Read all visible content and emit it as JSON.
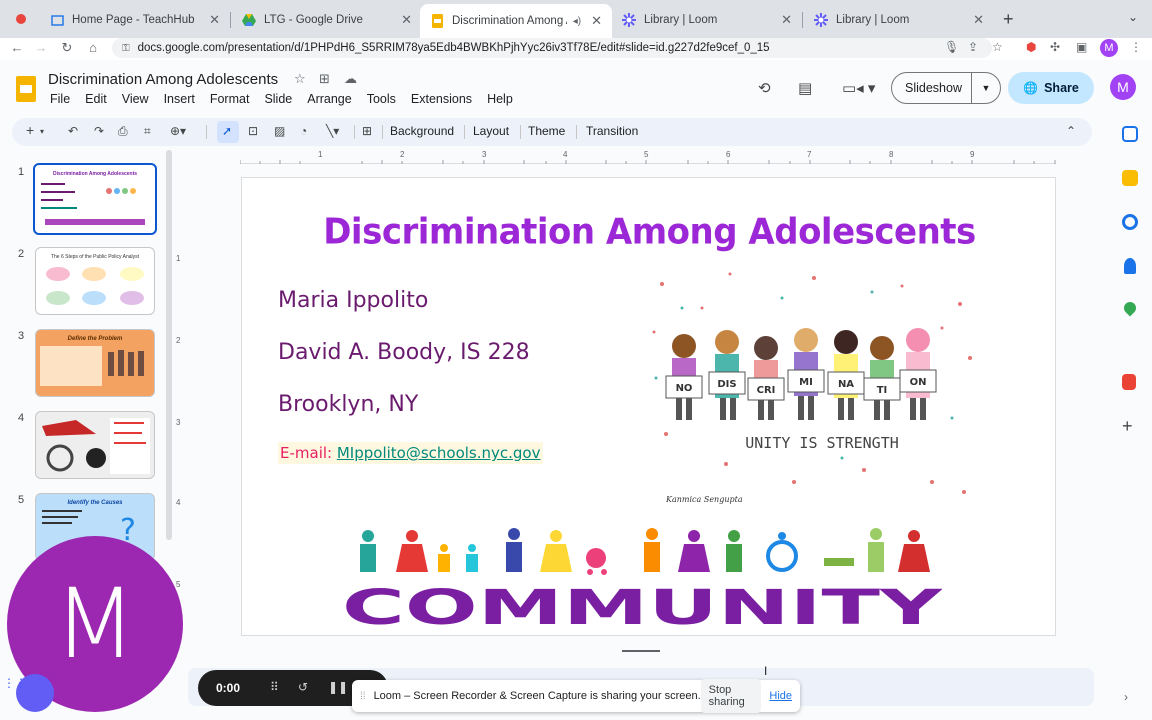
{
  "browser": {
    "tabs": [
      {
        "title": "Home Page - TeachHub",
        "icon": "teachhub-icon",
        "close": "✕"
      },
      {
        "title": "LTG - Google Drive",
        "icon": "drive-icon",
        "close": "✕"
      },
      {
        "title": "Discrimination Among Ado",
        "icon": "slides-icon",
        "close": "✕",
        "active": true
      },
      {
        "title": "Library | Loom",
        "icon": "loom-icon",
        "close": "✕"
      },
      {
        "title": "Library | Loom",
        "icon": "loom-icon",
        "close": "✕"
      }
    ],
    "new_tab": "+",
    "url": "docs.google.com/presentation/d/1PHPdH6_S5RRIM78ya5Edb4BWBKhPjhYyc26iv3Tf78E/edit#slide=id.g227d2fe9cef_0_15",
    "profile_initial": "M"
  },
  "doc": {
    "title": "Discrimination Among Adolescents",
    "menu": [
      "File",
      "Edit",
      "View",
      "Insert",
      "Format",
      "Slide",
      "Arrange",
      "Tools",
      "Extensions",
      "Help"
    ],
    "slideshow_label": "Slideshow",
    "share_label": "Share",
    "profile_initial": "M"
  },
  "toolbar": {
    "background": "Background",
    "layout": "Layout",
    "theme": "Theme",
    "transition": "Transition"
  },
  "filmstrip": {
    "slides": [
      {
        "number": "1",
        "caption": "Discrimination Among Adolescents"
      },
      {
        "number": "2",
        "caption": "The 6 Steps of the Public Policy Analyst"
      },
      {
        "number": "3",
        "caption": "Define the Problem"
      },
      {
        "number": "4",
        "caption": ""
      },
      {
        "number": "5",
        "caption": "Identify the Causes"
      }
    ]
  },
  "ruler": {
    "h": [
      "1",
      "2",
      "3",
      "4",
      "5",
      "6",
      "7",
      "8",
      "9"
    ],
    "v": [
      "1",
      "2",
      "3",
      "4",
      "5"
    ]
  },
  "slide": {
    "title": "Discrimination Among Adolescents",
    "author": "Maria Ippolito",
    "school": "David A. Boody, IS 228",
    "location": "Brooklyn, NY",
    "email_label": "E-mail: ",
    "email": "MIppolito@schools.nyc.gov",
    "sign_letters": [
      "NO",
      "DIS",
      "CRI",
      "MI",
      "NA",
      "TI",
      "ON"
    ],
    "unity_text": "UNITY IS STRENGTH",
    "artist_signature": "Kanmica Sengupta",
    "community_word": "COMMUNITY"
  },
  "loom": {
    "avatar_initial": "M",
    "timer": "0:00",
    "share_message": "Loom – Screen Recorder & Screen Capture is sharing your screen.",
    "stop_label": "Stop sharing",
    "hide_label": "Hide"
  },
  "colors": {
    "title_purple": "#9c27d6",
    "text_plum": "#6a1b6e",
    "accent_blue": "#0b57d0",
    "share_blue": "#c2e7ff",
    "loom_purple": "#9c27b0"
  }
}
